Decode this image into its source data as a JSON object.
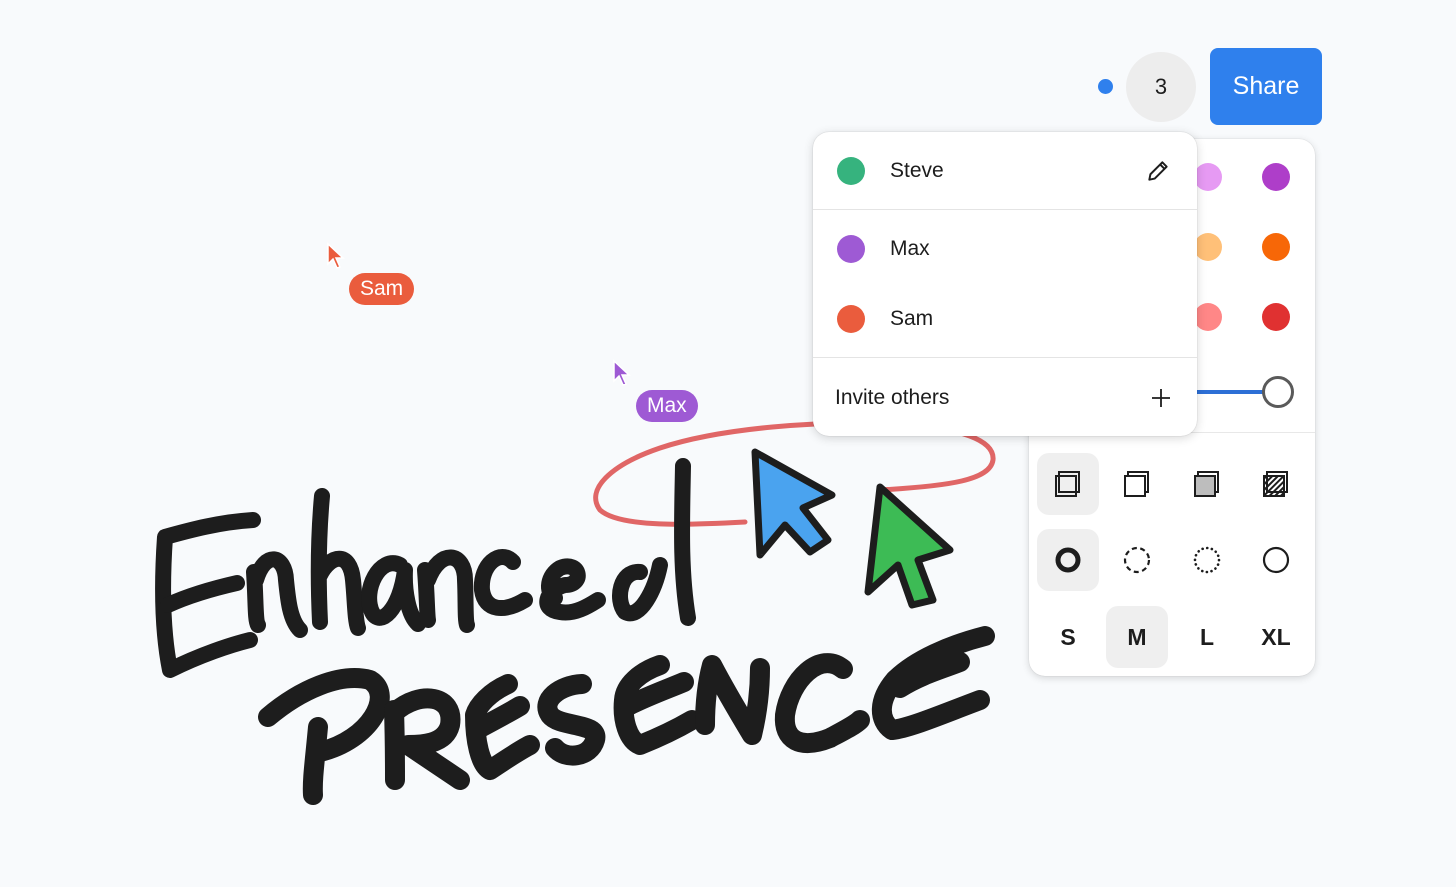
{
  "header": {
    "presence_indicator_color": "#2f80ed",
    "participant_count": "3",
    "share_label": "Share",
    "share_color": "#2f80ed"
  },
  "people_menu": {
    "people": [
      {
        "name": "Steve",
        "color": "#36b37e",
        "editable": true
      },
      {
        "name": "Max",
        "color": "#9e5ad4"
      },
      {
        "name": "Sam",
        "color": "#ea5c3d"
      }
    ],
    "invite_label": "Invite others"
  },
  "style_panel": {
    "color_swatches_visible": [
      [
        "#e69af3",
        "#ae3ec9"
      ],
      [
        "#ffc078",
        "#f76707"
      ],
      [
        "#ff8787",
        "#e03131"
      ]
    ],
    "opacity_value": 1.0,
    "fill_options": [
      {
        "name": "none",
        "active": true
      },
      {
        "name": "semi",
        "active": false
      },
      {
        "name": "solid",
        "active": false
      },
      {
        "name": "pattern",
        "active": false
      }
    ],
    "dash_options": [
      {
        "name": "draw",
        "active": true
      },
      {
        "name": "dashed",
        "active": false
      },
      {
        "name": "dotted",
        "active": false
      },
      {
        "name": "solid",
        "active": false
      }
    ],
    "size_options": [
      {
        "label": "S",
        "active": false
      },
      {
        "label": "M",
        "active": true
      },
      {
        "label": "L",
        "active": false
      },
      {
        "label": "XL",
        "active": false
      }
    ]
  },
  "cursors": [
    {
      "name": "Sam",
      "color": "#ea5c3d"
    },
    {
      "name": "Max",
      "color": "#9e5ad4"
    }
  ],
  "artwork": {
    "headline_line1": "Enhanced",
    "headline_line2": "PRESENCE",
    "ink_color": "#1d1d1d",
    "loop_color": "#e06666",
    "drawn_cursor_colors": [
      "#4aa3ef",
      "#3dbb55"
    ]
  }
}
